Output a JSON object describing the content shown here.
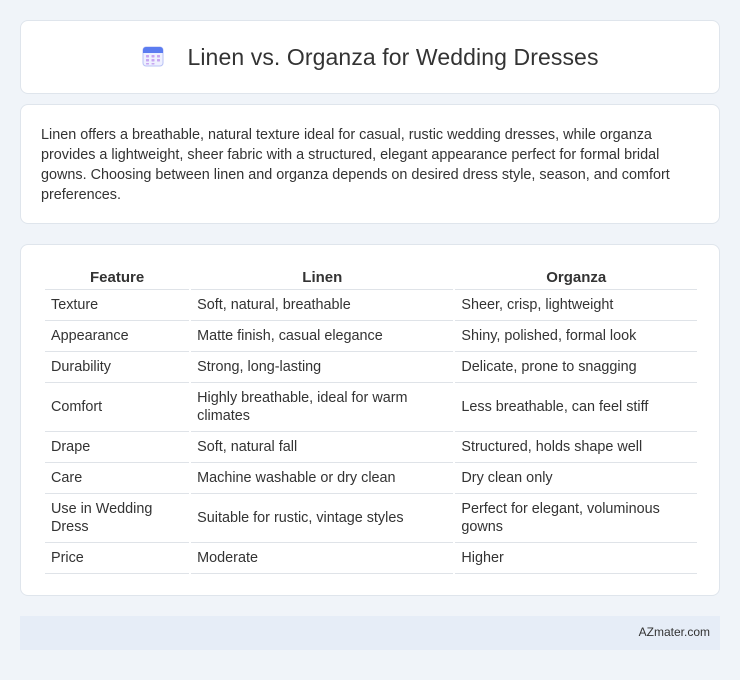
{
  "header": {
    "icon": "calendar-icon",
    "title": "Linen vs. Organza for Wedding Dresses"
  },
  "summary": {
    "text": "Linen offers a breathable, natural texture ideal for casual, rustic wedding dresses, while organza provides a lightweight, sheer fabric with a structured, elegant appearance perfect for formal bridal gowns. Choosing between linen and organza depends on desired dress style, season, and comfort preferences."
  },
  "table": {
    "headers": [
      "Feature",
      "Linen",
      "Organza"
    ],
    "rows": [
      [
        "Texture",
        "Soft, natural, breathable",
        "Sheer, crisp, lightweight"
      ],
      [
        "Appearance",
        "Matte finish, casual elegance",
        "Shiny, polished, formal look"
      ],
      [
        "Durability",
        "Strong, long-lasting",
        "Delicate, prone to snagging"
      ],
      [
        "Comfort",
        "Highly breathable, ideal for warm climates",
        "Less breathable, can feel stiff"
      ],
      [
        "Drape",
        "Soft, natural fall",
        "Structured, holds shape well"
      ],
      [
        "Care",
        "Machine washable or dry clean",
        "Dry clean only"
      ],
      [
        "Use in Wedding Dress",
        "Suitable for rustic, vintage styles",
        "Perfect for elegant, voluminous gowns"
      ],
      [
        "Price",
        "Moderate",
        "Higher"
      ]
    ]
  },
  "footer": {
    "brand": "AZmater.com"
  }
}
